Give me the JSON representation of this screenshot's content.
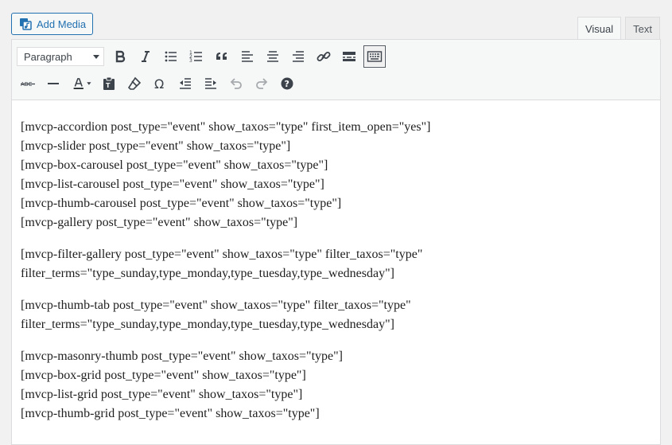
{
  "add_media": {
    "label": "Add Media"
  },
  "tabs": [
    {
      "label": "Visual"
    },
    {
      "label": "Text"
    }
  ],
  "toolbar": {
    "format_select": {
      "value": "Paragraph"
    }
  },
  "content": {
    "paragraphs": [
      [
        "[mvcp-accordion post_type=\"event\" show_taxos=\"type\" first_item_open=\"yes\"]",
        "[mvcp-slider post_type=\"event\" show_taxos=\"type\"]",
        "[mvcp-box-carousel post_type=\"event\" show_taxos=\"type\"]",
        "[mvcp-list-carousel post_type=\"event\" show_taxos=\"type\"]",
        "[mvcp-thumb-carousel post_type=\"event\" show_taxos=\"type\"]",
        "[mvcp-gallery post_type=\"event\" show_taxos=\"type\"]"
      ],
      [
        "[mvcp-filter-gallery post_type=\"event\" show_taxos=\"type\" filter_taxos=\"type\"",
        "filter_terms=\"type_sunday,type_monday,type_tuesday,type_wednesday\"]"
      ],
      [
        "[mvcp-thumb-tab post_type=\"event\" show_taxos=\"type\" filter_taxos=\"type\"",
        "filter_terms=\"type_sunday,type_monday,type_tuesday,type_wednesday\"]"
      ],
      [
        "[mvcp-masonry-thumb post_type=\"event\" show_taxos=\"type\"]",
        "[mvcp-box-grid post_type=\"event\" show_taxos=\"type\"]",
        "[mvcp-list-grid post_type=\"event\" show_taxos=\"type\"]",
        "[mvcp-thumb-grid post_type=\"event\" show_taxos=\"type\"]"
      ]
    ]
  }
}
